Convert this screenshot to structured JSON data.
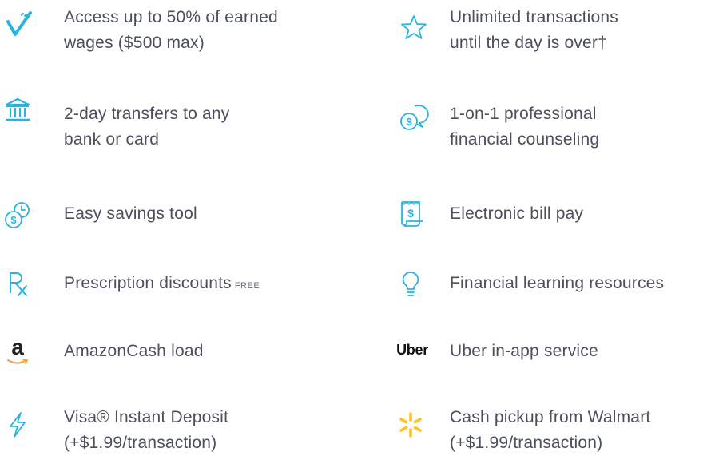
{
  "colors": {
    "accent": "#2bb3e0",
    "text": "#4b5059",
    "walmart": "#ffc220",
    "amazon_arrow": "#f0a33c"
  },
  "features": [
    {
      "icon": "checkmark-icon",
      "line1": "Access up to 50% of earned",
      "line2": "wages ($500 max)"
    },
    {
      "icon": "star-icon",
      "line1": "Unlimited transactions",
      "line2": "until the day is over†"
    },
    {
      "icon": "bank-icon",
      "line1": "2-day transfers to any",
      "line2": "bank or card"
    },
    {
      "icon": "chat-dollar-icon",
      "line1": "1-on-1 professional",
      "line2": "financial counseling"
    },
    {
      "icon": "savings-clock-icon",
      "line1": "Easy savings tool"
    },
    {
      "icon": "receipt-icon",
      "line1": "Electronic bill pay"
    },
    {
      "icon": "prescription-icon",
      "line1": "Prescription discounts",
      "tag": "FREE"
    },
    {
      "icon": "lightbulb-icon",
      "line1": "Financial learning resources"
    },
    {
      "icon": "amazon-logo-icon",
      "logo_text": "a",
      "line1": "AmazonCash load"
    },
    {
      "icon": "uber-logo-icon",
      "logo_text": "Uber",
      "line1": "Uber in-app service"
    },
    {
      "icon": "lightning-icon",
      "line1": "Visa® Instant Deposit",
      "line2": "(+$1.99/transaction)"
    },
    {
      "icon": "walmart-spark-icon",
      "line1": "Cash pickup from Walmart",
      "line2": "(+$1.99/transaction)"
    }
  ]
}
